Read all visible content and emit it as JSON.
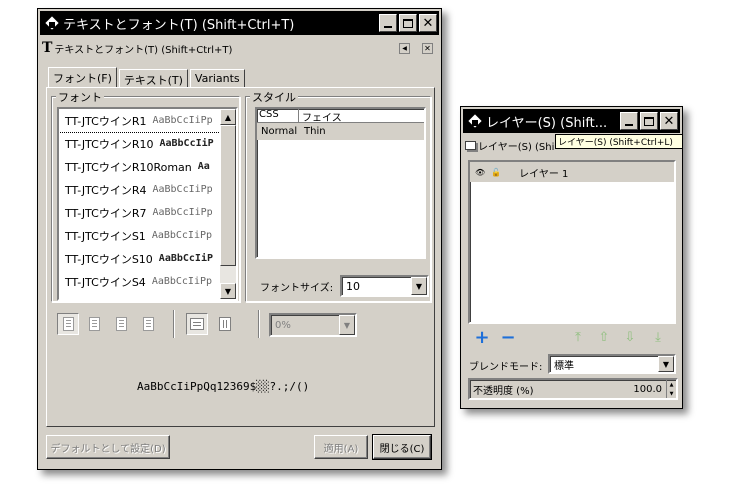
{
  "text_window": {
    "title": "テキストとフォント(T) (Shift+Ctrl+T)",
    "panel_title": "テキストとフォント(T) (Shift+Ctrl+T)",
    "tabs": [
      {
        "label": "フォント(F)",
        "active": true
      },
      {
        "label": "テキスト(T)",
        "active": false
      },
      {
        "label": "Variants",
        "active": false
      }
    ],
    "font_group_label": "フォント",
    "fonts": [
      {
        "name": "TT-JTCウインR1",
        "preview": "AaBbCcIiPp",
        "bold": false,
        "selected": true
      },
      {
        "name": "TT-JTCウインR10",
        "preview": "AaBbCcIiP",
        "bold": true,
        "selected": false
      },
      {
        "name": "TT-JTCウインR10Roman",
        "preview": "Aa",
        "bold": true,
        "selected": false
      },
      {
        "name": "TT-JTCウインR4",
        "preview": "AaBbCcIiPp",
        "bold": false,
        "selected": false
      },
      {
        "name": "TT-JTCウインR7",
        "preview": "AaBbCcIiPp",
        "bold": false,
        "selected": false
      },
      {
        "name": "TT-JTCウインS1",
        "preview": "AaBbCcIiPp",
        "bold": false,
        "selected": false
      },
      {
        "name": "TT-JTCウインS10",
        "preview": "AaBbCcIiP",
        "bold": true,
        "selected": false
      },
      {
        "name": "TT-JTCウインS4",
        "preview": "AaBbCcIiPp",
        "bold": false,
        "selected": false
      }
    ],
    "style_group_label": "スタイル",
    "style_columns": [
      "CSS",
      "フェイス"
    ],
    "style_rows": [
      {
        "css": "Normal",
        "face": "Thin"
      }
    ],
    "font_size_label": "フォントサイズ:",
    "font_size_value": "10",
    "spacing_value": "0%",
    "preview_text": "AaBbCcIiPpQq12369$░░?.;/()",
    "default_button": "デフォルトとして設定(D)",
    "apply_button": "適用(A)",
    "close_button": "閉じる(C)"
  },
  "layer_window": {
    "title": "レイヤー(S) (Shift...",
    "panel_title": "レイヤー(S) (Shi",
    "tooltip": "レイヤー(S) (Shift+Ctrl+L)",
    "layers": [
      {
        "name": "レイヤー 1"
      }
    ],
    "blend_mode_label": "ブレンドモード:",
    "blend_mode_value": "標準",
    "opacity_label": "不透明度 (%)",
    "opacity_value": "100.0"
  }
}
